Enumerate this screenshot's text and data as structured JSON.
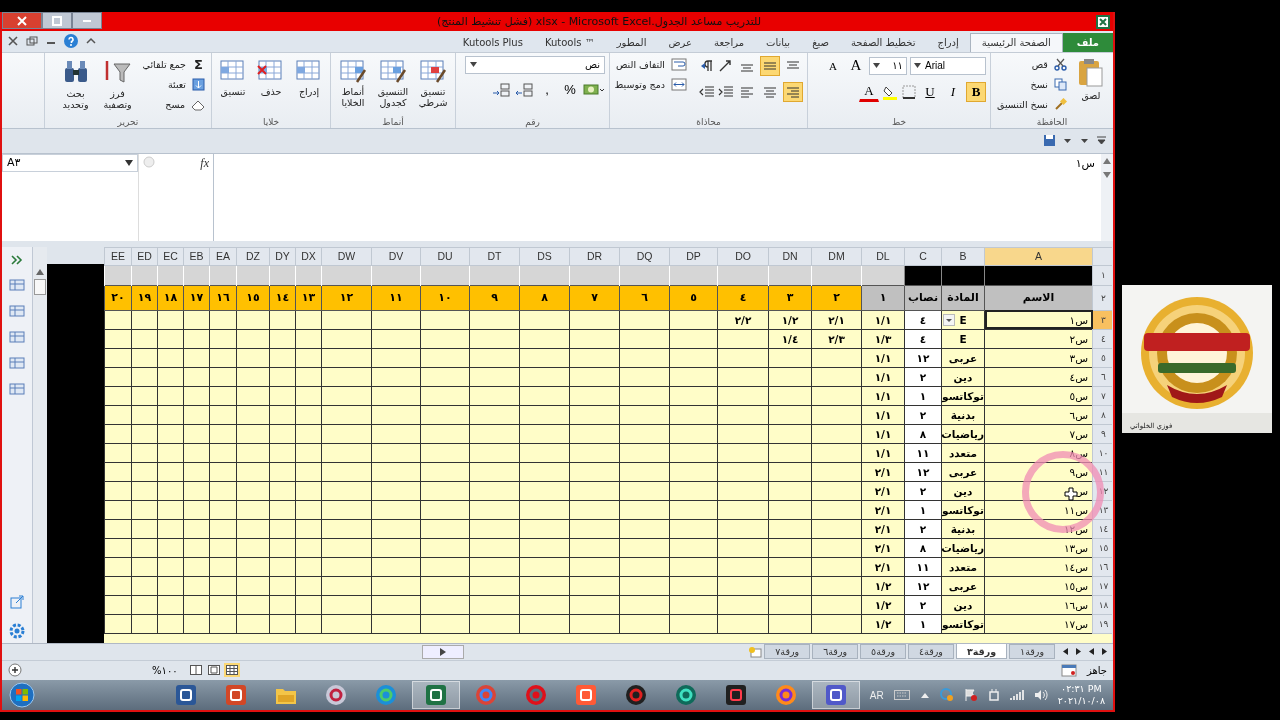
{
  "window": {
    "title": "للتدريب مساعد الجدول.xlsx - Microsoft Excel (فشل تنشيط المنتج)"
  },
  "ribbon_tabs": [
    {
      "label": "ملف",
      "kind": "file",
      "selected": false
    },
    {
      "label": "الصفحة الرئيسية",
      "kind": "tab",
      "selected": true
    },
    {
      "label": "إدراج",
      "kind": "tab",
      "selected": false
    },
    {
      "label": "تخطيط الصفحة",
      "kind": "tab",
      "selected": false
    },
    {
      "label": "صيغ",
      "kind": "tab",
      "selected": false
    },
    {
      "label": "بيانات",
      "kind": "tab",
      "selected": false
    },
    {
      "label": "مراجعة",
      "kind": "tab",
      "selected": false
    },
    {
      "label": "عرض",
      "kind": "tab",
      "selected": false
    },
    {
      "label": "المطور",
      "kind": "tab",
      "selected": false
    },
    {
      "label": "Kutools ™",
      "kind": "tab",
      "selected": false
    },
    {
      "label": "Kutools Plus",
      "kind": "tab",
      "selected": false
    }
  ],
  "ribbon_groups": [
    {
      "kind": "clipboard",
      "title": "الحافظة",
      "buttons": [
        {
          "label": "لصق"
        },
        {
          "label": "قص"
        },
        {
          "label": "نسخ"
        },
        {
          "label": "نسخ التنسيق"
        }
      ]
    },
    {
      "kind": "font",
      "title": "خط",
      "font": "Arial",
      "size": "١١",
      "grow": "A",
      "shrink": "A",
      "font_color": "A",
      "styles": [
        {
          "label": "B",
          "selected": true
        },
        {
          "label": "I",
          "selected": false
        },
        {
          "label": "U",
          "selected": false
        }
      ]
    },
    {
      "kind": "alignment",
      "title": "محاذاة",
      "vertical": [
        {
          "selected": false
        },
        {
          "selected": true
        },
        {
          "selected": false
        }
      ],
      "horizontal": [
        {
          "selected": true
        },
        {
          "selected": false
        },
        {
          "selected": false
        }
      ],
      "buttons": [
        {
          "label": "التفاف النص"
        },
        {
          "label": "دمج وتوسيط"
        }
      ]
    },
    {
      "kind": "number",
      "title": "رقم",
      "format": "نص",
      "symbols": [
        "%",
        ","
      ]
    },
    {
      "kind": "large",
      "title": "أنماط",
      "buttons": [
        {
          "label": "تنسيق شرطي"
        },
        {
          "label": "التنسيق كجدول"
        },
        {
          "label": "أنماط الخلايا"
        }
      ]
    },
    {
      "kind": "large",
      "title": "خلايا",
      "buttons": [
        {
          "label": "إدراج"
        },
        {
          "label": "حذف"
        },
        {
          "label": "تنسيق"
        }
      ]
    },
    {
      "kind": "editing",
      "title": "تحرير",
      "symbol": "Σ",
      "buttons": [
        {
          "label": "جمع تلقائي"
        },
        {
          "label": "تعبئة"
        },
        {
          "label": "مسح"
        },
        {
          "label": "فرز وتصفية"
        },
        {
          "label": "بحث وتحديد"
        }
      ]
    }
  ],
  "formula_bar": {
    "name_box": "A٣",
    "fx": "fx",
    "formula": "س١"
  },
  "row_headers": [
    "١",
    "٢"
  ],
  "columns": [
    {
      "letter": "A",
      "kind": "field",
      "heading": "الاسم",
      "color": "#c0c0c0",
      "selected": true
    },
    {
      "letter": "B",
      "kind": "field",
      "heading": "المادة",
      "color": "#c0c0c0",
      "selected": false
    },
    {
      "letter": "C",
      "kind": "field",
      "heading": "نصاب",
      "color": "#c0c0c0",
      "selected": false
    },
    {
      "letter": "DL",
      "kind": "period",
      "heading": "١",
      "color": "#c0c0c0",
      "selected": false
    },
    {
      "letter": "DM",
      "kind": "period",
      "heading": "٢",
      "color": "#ffc000",
      "selected": false
    },
    {
      "letter": "DN",
      "kind": "period",
      "heading": "٣",
      "color": "#ffc000",
      "selected": false
    },
    {
      "letter": "DO",
      "kind": "period",
      "heading": "٤",
      "color": "#ffc000",
      "selected": false
    },
    {
      "letter": "DP",
      "kind": "period",
      "heading": "٥",
      "color": "#ffc000",
      "selected": false
    },
    {
      "letter": "DQ",
      "kind": "period",
      "heading": "٦",
      "color": "#ffc000",
      "selected": false
    },
    {
      "letter": "DR",
      "kind": "period",
      "heading": "٧",
      "color": "#ffc000",
      "selected": false
    },
    {
      "letter": "DS",
      "kind": "period",
      "heading": "٨",
      "color": "#ffc000",
      "selected": false
    },
    {
      "letter": "DT",
      "kind": "period",
      "heading": "٩",
      "color": "#ffc000",
      "selected": false
    },
    {
      "letter": "DU",
      "kind": "period",
      "heading": "١٠",
      "color": "#ffc000",
      "selected": false
    },
    {
      "letter": "DV",
      "kind": "period",
      "heading": "١١",
      "color": "#ffc000",
      "selected": false
    },
    {
      "letter": "DW",
      "kind": "period",
      "heading": "١٢",
      "color": "#ffc000",
      "selected": false
    },
    {
      "letter": "DX",
      "kind": "period",
      "heading": "١٣",
      "color": "#ffc000",
      "selected": false
    },
    {
      "letter": "DY",
      "kind": "period",
      "heading": "١٤",
      "color": "#ffc000",
      "selected": false
    },
    {
      "letter": "DZ",
      "kind": "period",
      "heading": "١٥",
      "color": "#ffc000",
      "selected": false
    },
    {
      "letter": "EA",
      "kind": "period",
      "heading": "١٦",
      "color": "#ffc000",
      "selected": false
    },
    {
      "letter": "EB",
      "kind": "period",
      "heading": "١٧",
      "color": "#ffc000",
      "selected": false
    },
    {
      "letter": "EC",
      "kind": "period",
      "heading": "١٨",
      "color": "#ffc000",
      "selected": false
    },
    {
      "letter": "ED",
      "kind": "period",
      "heading": "١٩",
      "color": "#ffc000",
      "selected": false
    },
    {
      "letter": "EE",
      "kind": "period",
      "heading": "٢٠",
      "color": "#ffc000",
      "selected": false
    }
  ],
  "rows": [
    {
      "number": "٣",
      "selected": true,
      "cells": [
        "س١",
        "E",
        "٤",
        "١/١",
        "٢/١",
        "١/٢",
        "٢/٢"
      ]
    },
    {
      "number": "٤",
      "selected": false,
      "cells": [
        "س٢",
        "E",
        "٤",
        "١/٣",
        "٢/٣",
        "١/٤"
      ]
    },
    {
      "number": "٥",
      "selected": false,
      "cells": [
        "س٣",
        "عربى",
        "١٢",
        "١/١"
      ]
    },
    {
      "number": "٦",
      "selected": false,
      "cells": [
        "س٤",
        "دين",
        "٢",
        "١/١"
      ]
    },
    {
      "number": "٧",
      "selected": false,
      "cells": [
        "س٥",
        "توكاتسو",
        "١",
        "١/١"
      ]
    },
    {
      "number": "٨",
      "selected": false,
      "cells": [
        "س٦",
        "بدنية",
        "٢",
        "١/١"
      ]
    },
    {
      "number": "٩",
      "selected": false,
      "cells": [
        "س٧",
        "رياضيات",
        "٨",
        "١/١"
      ]
    },
    {
      "number": "١٠",
      "selected": false,
      "cells": [
        "س٨",
        "متعدد",
        "١١",
        "١/١"
      ]
    },
    {
      "number": "١١",
      "selected": false,
      "cells": [
        "س٩",
        "عربى",
        "١٢",
        "٢/١"
      ]
    },
    {
      "number": "١٢",
      "selected": false,
      "cells": [
        "س",
        "دين",
        "٢",
        "٢/١"
      ]
    },
    {
      "number": "١٣",
      "selected": false,
      "cells": [
        "س١١",
        "توكاتسو",
        "١",
        "٢/١"
      ]
    },
    {
      "number": "١٤",
      "selected": false,
      "cells": [
        "س١٢",
        "بدنية",
        "٢",
        "٢/١"
      ]
    },
    {
      "number": "١٥",
      "selected": false,
      "cells": [
        "س١٣",
        "رياضيات",
        "٨",
        "٢/١"
      ]
    },
    {
      "number": "١٦",
      "selected": false,
      "cells": [
        "س١٤",
        "متعدد",
        "١١",
        "٢/١"
      ]
    },
    {
      "number": "١٧",
      "selected": false,
      "cells": [
        "س١٥",
        "عربى",
        "١٢",
        "١/٢"
      ]
    },
    {
      "number": "١٨",
      "selected": false,
      "cells": [
        "س١٦",
        "دين",
        "٢",
        "١/٢"
      ]
    },
    {
      "number": "١٩",
      "selected": false,
      "cells": [
        "س١٧",
        "توكاتسو",
        "١",
        "١/٢"
      ]
    }
  ],
  "sheet_tabs": [
    {
      "label": "ورقة١",
      "selected": false
    },
    {
      "label": "ورقة٣",
      "selected": true
    },
    {
      "label": "ورقة٤",
      "selected": false
    },
    {
      "label": "ورقة٥",
      "selected": false
    },
    {
      "label": "ورقة٦",
      "selected": false
    },
    {
      "label": "ورقة٧",
      "selected": false
    }
  ],
  "status_bar": {
    "text": "جاهز",
    "zoom": "%١٠٠",
    "views": [
      {
        "selected": false
      },
      {
        "selected": false
      },
      {
        "selected": true
      }
    ]
  },
  "taskbar": {
    "apps": [
      {
        "selected": false
      },
      {
        "selected": false
      },
      {
        "selected": false
      },
      {
        "selected": false
      },
      {
        "selected": false
      },
      {
        "selected": true
      },
      {
        "selected": false
      },
      {
        "selected": false
      },
      {
        "selected": false
      },
      {
        "selected": false
      },
      {
        "selected": false
      },
      {
        "selected": false
      },
      {
        "selected": false
      },
      {
        "selected": true
      }
    ],
    "language": "AR",
    "time": "٠٢:٣١ PM",
    "date": "٢٠٢١/١٠/٠٨"
  },
  "webcam": {
    "caption": "فوزي الخلواتي"
  }
}
